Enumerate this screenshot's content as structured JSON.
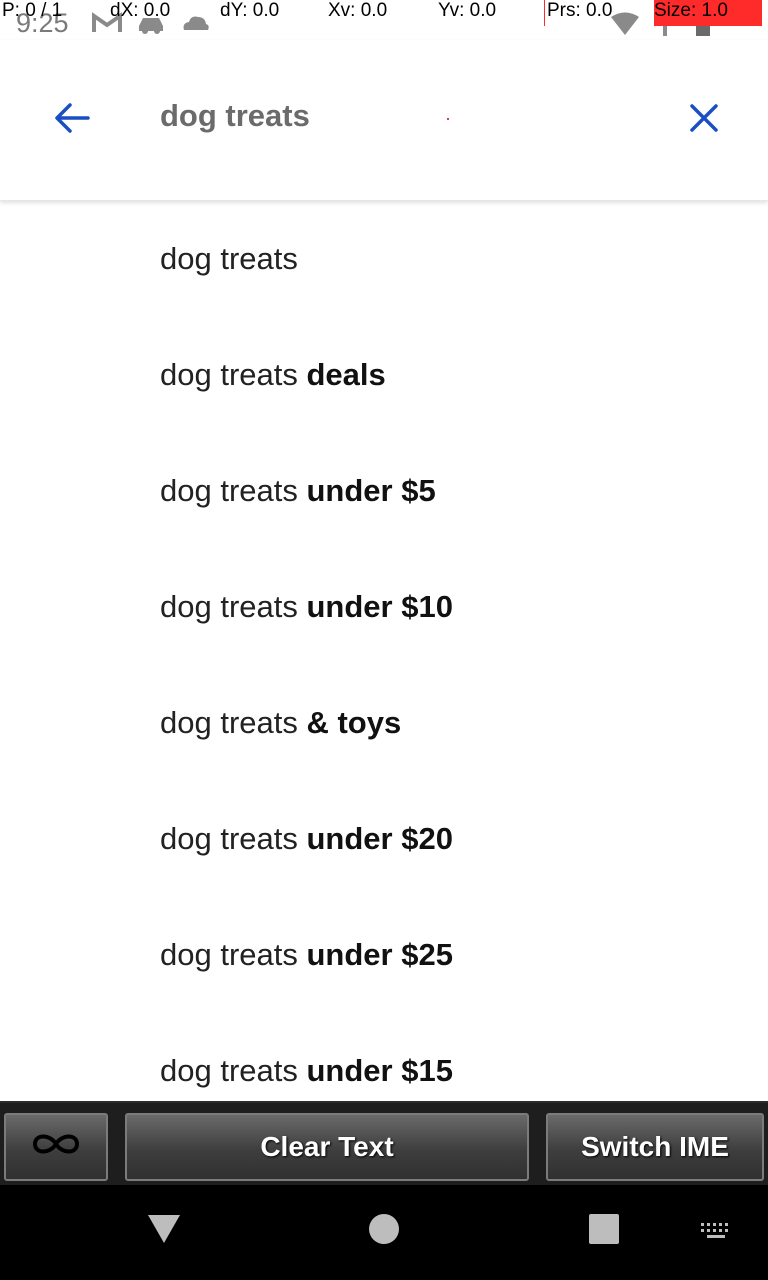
{
  "status_bar": {
    "time": "9:25",
    "debug": {
      "p": "P: 0 / 1",
      "dx": "dX: 0.0",
      "dy": "dY: 0.0",
      "xv": "Xv: 0.0",
      "yv": "Yv: 0.0",
      "prs": "Prs: 0.0",
      "size": "Size: 1.0"
    },
    "icons": [
      "gmail-icon",
      "car-icon",
      "cloud-icon",
      "wifi-icon",
      "signal-icon",
      "battery-icon"
    ]
  },
  "search": {
    "query": "dog treats"
  },
  "suggestions": [
    {
      "base": "dog treats",
      "extra": ""
    },
    {
      "base": "dog treats ",
      "extra": "deals"
    },
    {
      "base": "dog treats ",
      "extra": "under $5"
    },
    {
      "base": "dog treats ",
      "extra": "under $10"
    },
    {
      "base": "dog treats ",
      "extra": "& toys"
    },
    {
      "base": "dog treats ",
      "extra": "under $20"
    },
    {
      "base": "dog treats ",
      "extra": "under $25"
    },
    {
      "base": "dog treats ",
      "extra": "under $15"
    }
  ],
  "toolbar": {
    "clear_label": "Clear Text",
    "switch_label": "Switch IME"
  },
  "colors": {
    "accent": "#1a4fc4",
    "toolbar_bg": "#1e1e1e",
    "navbar_bg": "#000000"
  }
}
